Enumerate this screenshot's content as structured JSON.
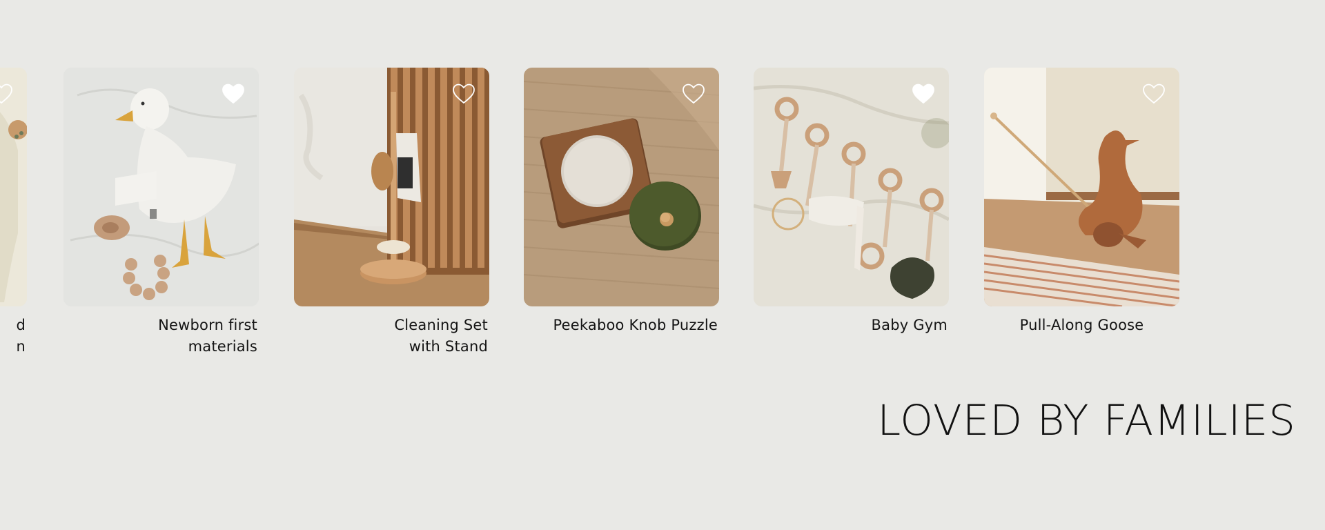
{
  "carousel": {
    "items": [
      {
        "label": "",
        "liked": false
      },
      {
        "label": "Newborn first materials",
        "liked": true
      },
      {
        "label": "Cleaning Set with Stand",
        "liked": false
      },
      {
        "label": "Peekaboo Knob Puzzle",
        "liked": false
      },
      {
        "label": "Baby Gym",
        "liked": true
      },
      {
        "label": "Pull-Along Goose",
        "liked": false
      }
    ],
    "partial_caption": [
      "d",
      "n"
    ]
  },
  "section": {
    "heading": "LOVED BY FAMILIES"
  },
  "colors": {
    "background": "#e9e9e6",
    "text": "#141414",
    "heart": "#ffffff"
  }
}
